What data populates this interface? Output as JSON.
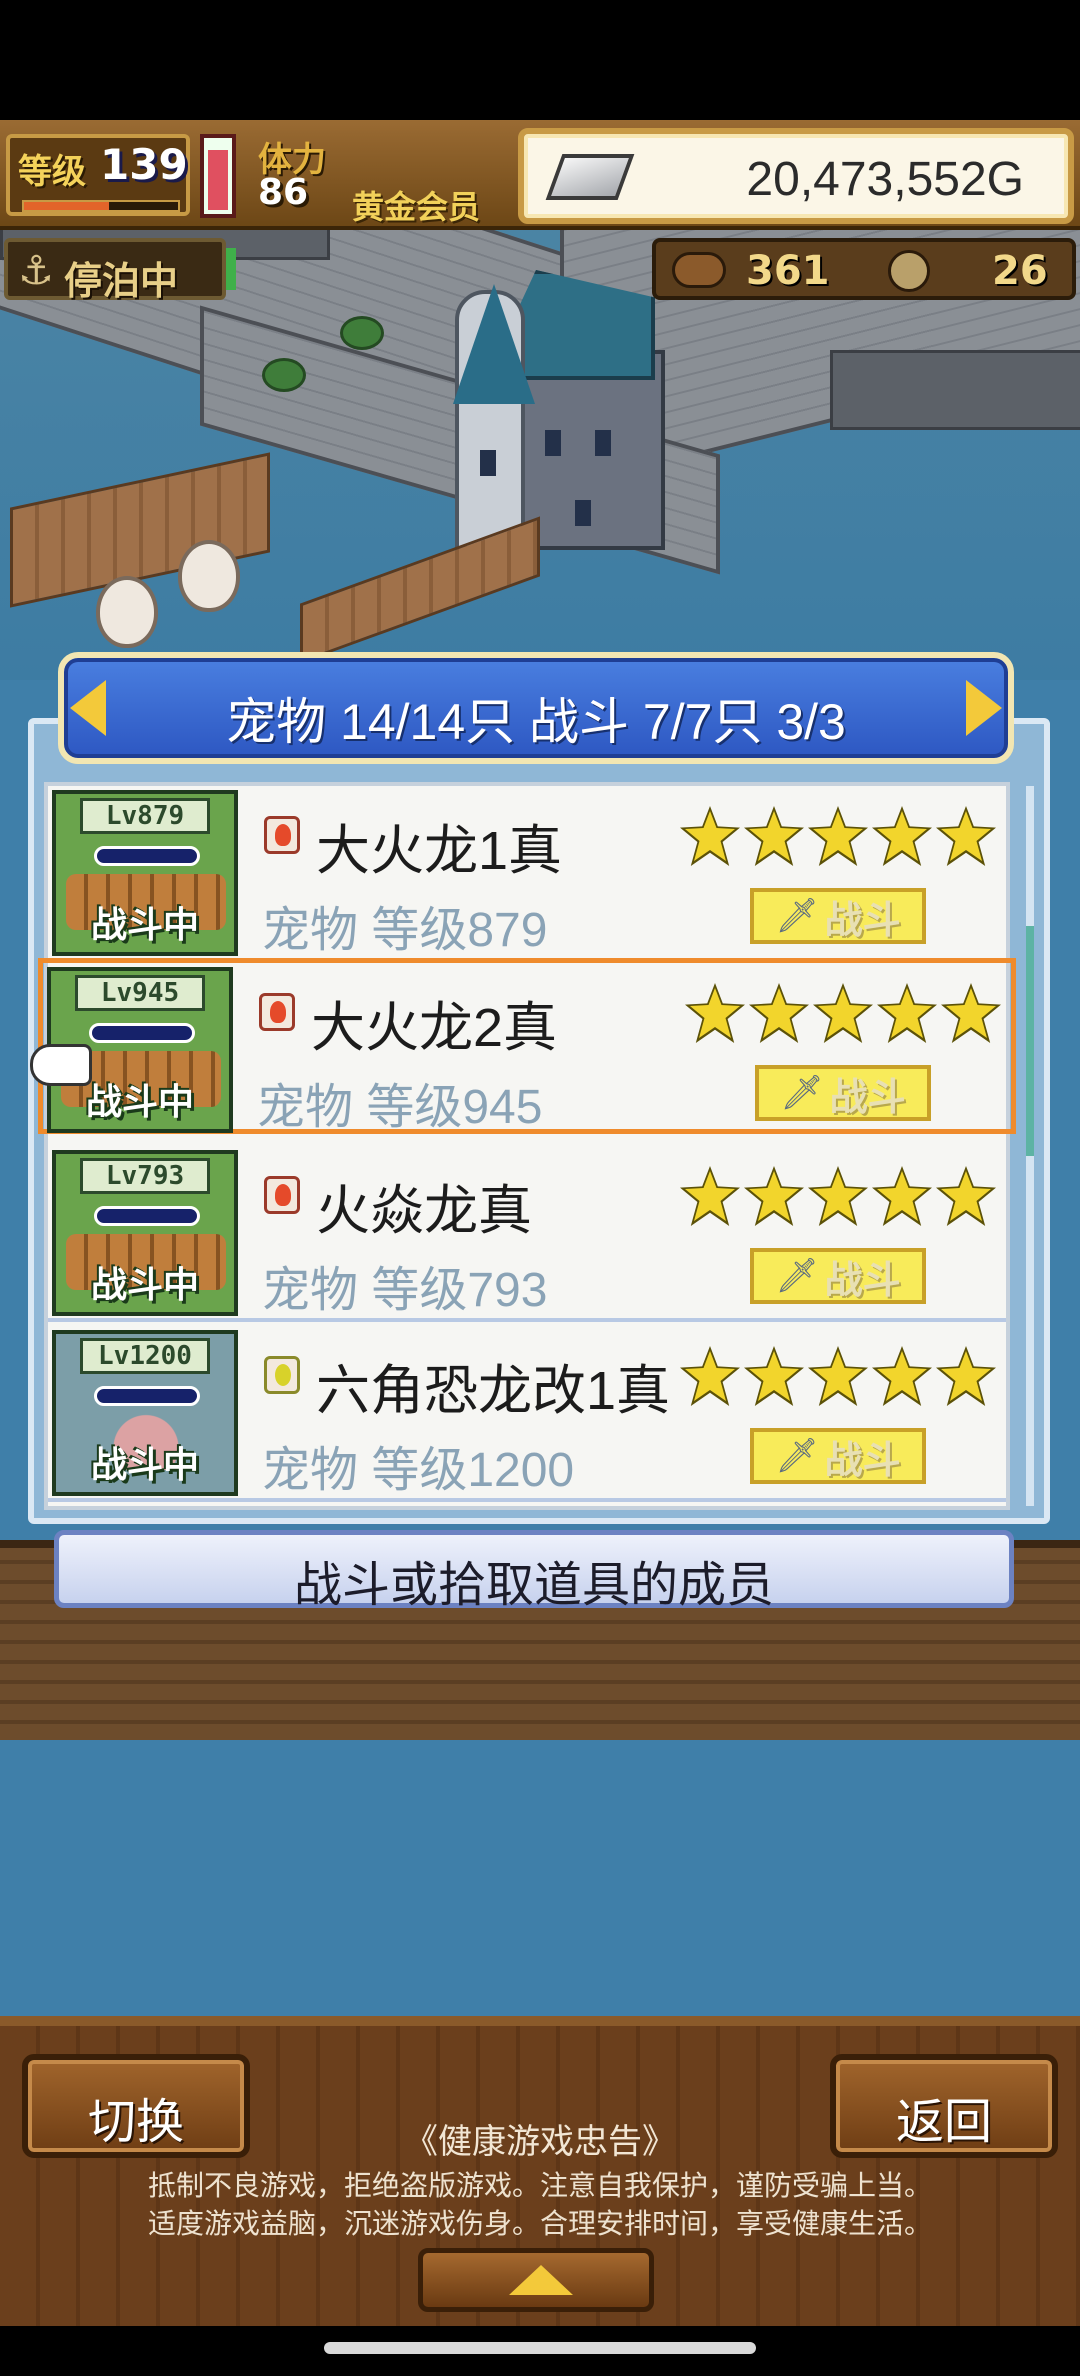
{
  "hud": {
    "level_label": "等级",
    "level_value": "139",
    "level_exp_fraction": 0.55,
    "hp_fraction": 0.9,
    "stamina_label": "体力",
    "stamina_value": "86",
    "member_label": "黄金会员",
    "gold": "20,473,552G"
  },
  "status": {
    "anchor_text": "停泊中",
    "resource_1": "361",
    "resource_2": "26"
  },
  "panel": {
    "title": "宠物 14/14只 战斗 7/7只  3/3"
  },
  "pets": [
    {
      "thumb_lv": "Lv879",
      "status": "战斗中",
      "element": "fire",
      "name": "大火龙1真",
      "sub": "宠物 等级879",
      "stars": 5,
      "button": "战斗",
      "selected": false
    },
    {
      "thumb_lv": "Lv945",
      "status": "战斗中",
      "element": "fire",
      "name": "大火龙2真",
      "sub": "宠物 等级945",
      "stars": 5,
      "button": "战斗",
      "selected": true
    },
    {
      "thumb_lv": "Lv793",
      "status": "战斗中",
      "element": "fire",
      "name": "火焱龙真",
      "sub": "宠物 等级793",
      "stars": 5,
      "button": "战斗",
      "selected": false
    },
    {
      "thumb_lv": "Lv1200",
      "status": "战斗中",
      "element": "earth",
      "name": "六角恐龙改1真",
      "sub": "宠物 等级1200",
      "stars": 5,
      "button": "战斗",
      "selected": false
    }
  ],
  "member_button": "战斗或拾取道具的成员",
  "bottom": {
    "switch_label": "切换",
    "back_label": "返回",
    "notice_title": "《健康游戏忠告》",
    "notice_line_1": "抵制不良游戏，拒绝盗版游戏。注意自我保护，谨防受骗上当。",
    "notice_line_2": "适度游戏益脑，沉迷游戏伤身。合理安排时间，享受健康生活。"
  },
  "icons": {
    "gold": "silver-ingot-icon",
    "anchor": "anchor-icon",
    "battle": "sword-icon",
    "pointer": "pointing-hand-icon",
    "up": "up-arrow-icon"
  },
  "colors": {
    "header_blue": "#3568d0",
    "selected_border": "#ef8b2c",
    "star": "#f2d52c",
    "battle_button": "#f8eb5a"
  }
}
